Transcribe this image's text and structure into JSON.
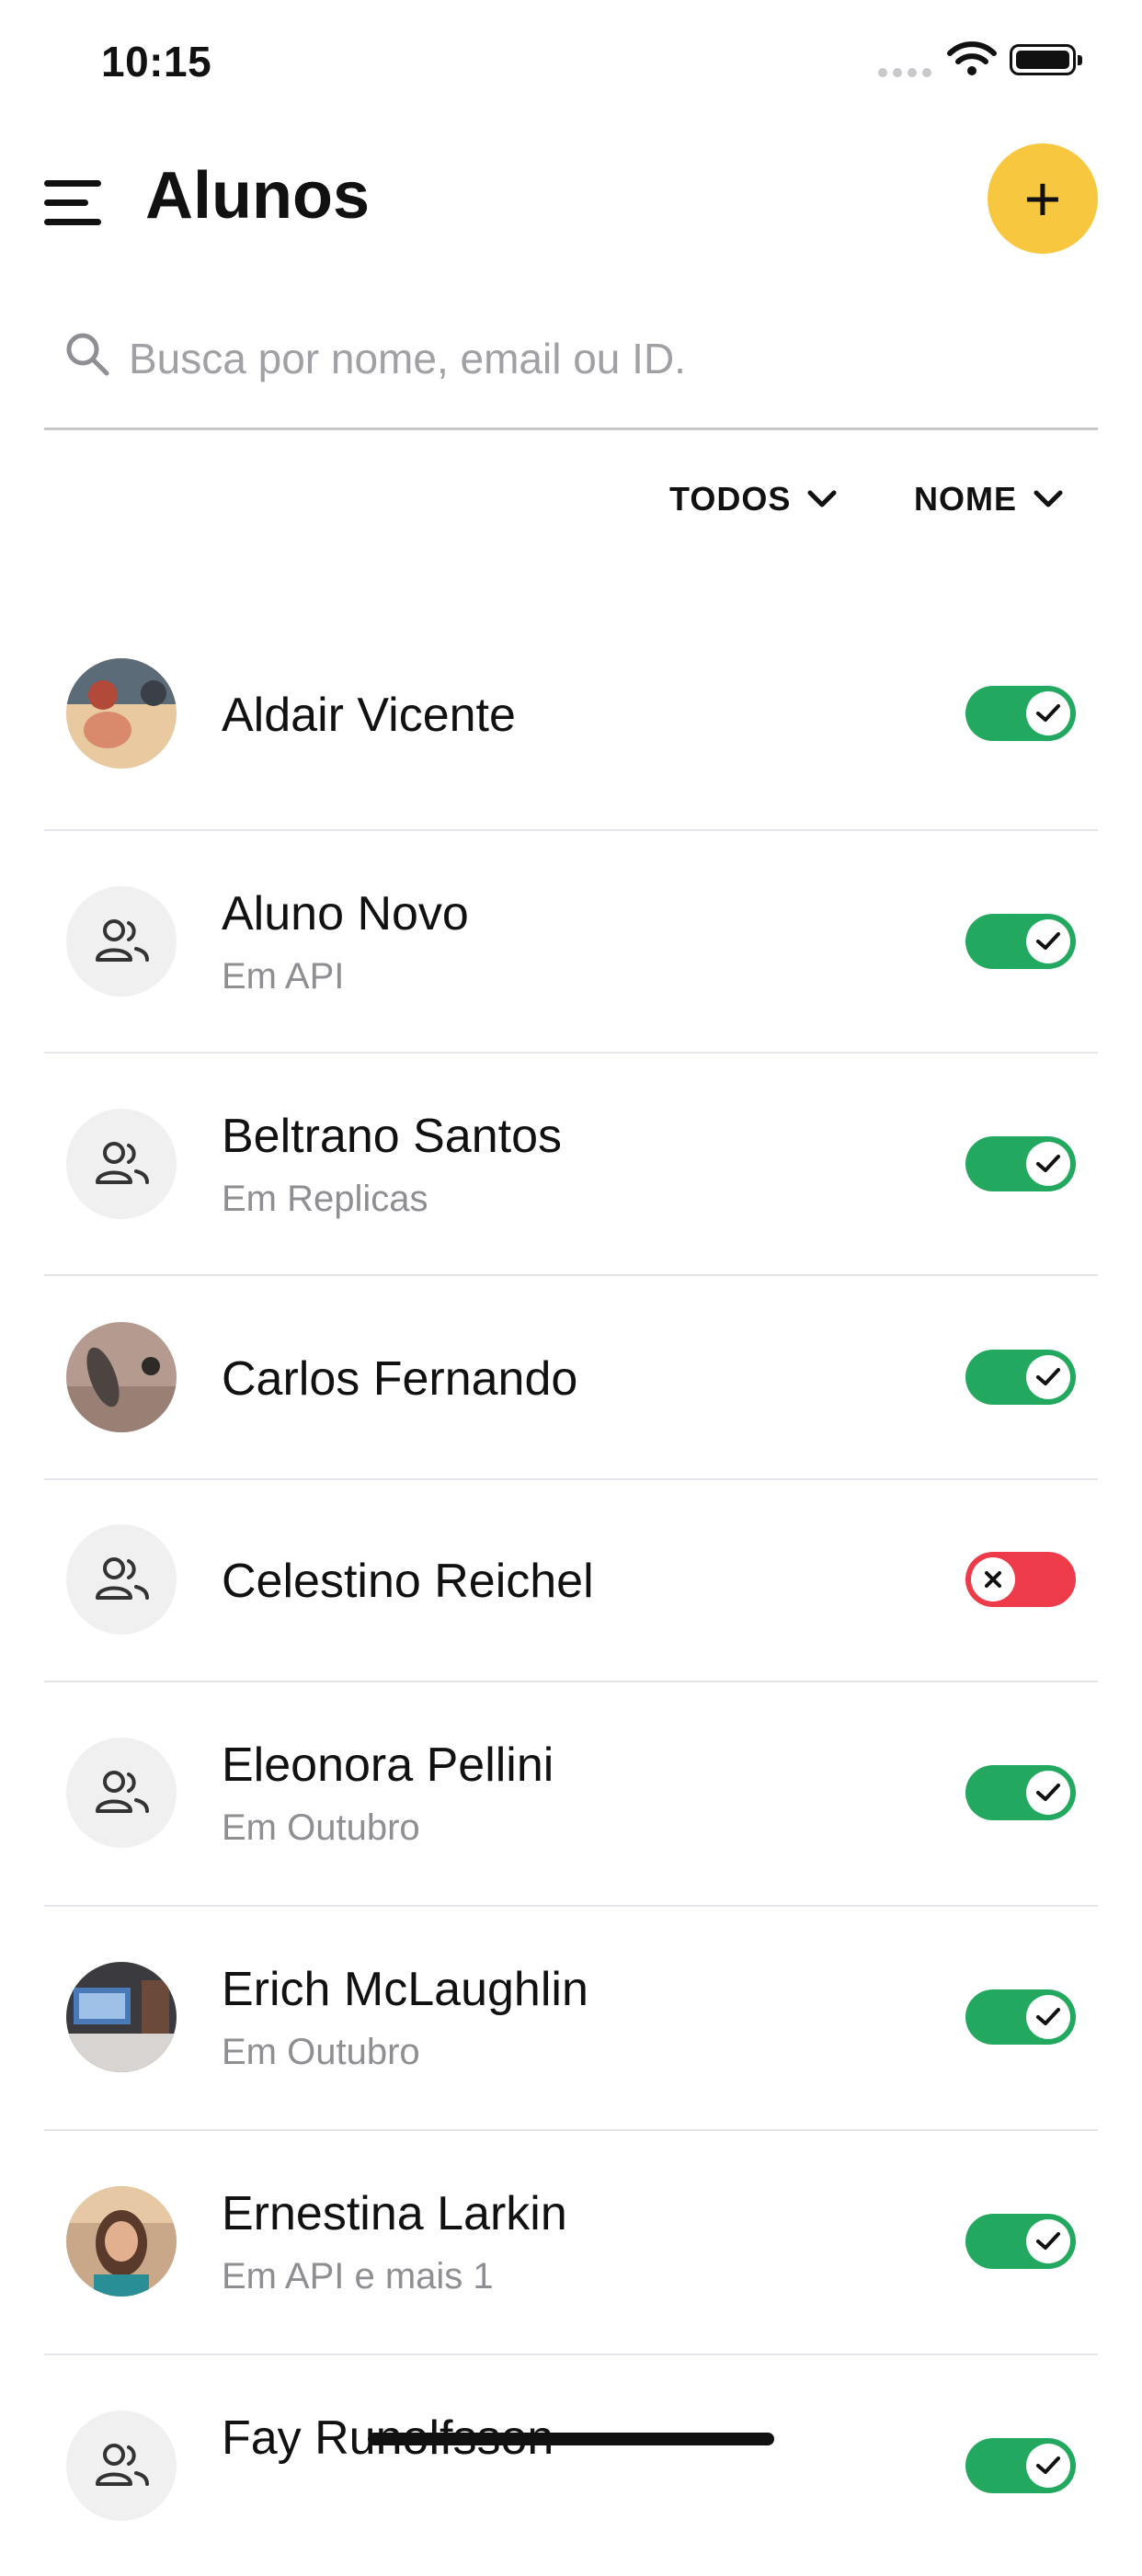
{
  "status_bar": {
    "time": "10:15"
  },
  "header": {
    "title": "Alunos",
    "add_label": "+"
  },
  "search": {
    "placeholder": "Busca por nome, email ou ID.",
    "value": ""
  },
  "filters": {
    "status_label": "TODOS",
    "sort_label": "NOME"
  },
  "students": [
    {
      "name": "Aldair Vicente",
      "subtitle": "",
      "avatar": "photo",
      "active": true
    },
    {
      "name": "Aluno Novo",
      "subtitle": "Em API",
      "avatar": "group-icon",
      "active": true
    },
    {
      "name": "Beltrano Santos",
      "subtitle": "Em Replicas",
      "avatar": "group-icon",
      "active": true
    },
    {
      "name": "Carlos Fernando",
      "subtitle": "",
      "avatar": "photo",
      "active": true
    },
    {
      "name": "Celestino Reichel",
      "subtitle": "",
      "avatar": "group-icon",
      "active": false
    },
    {
      "name": "Eleonora Pellini",
      "subtitle": "Em Outubro",
      "avatar": "group-icon",
      "active": true
    },
    {
      "name": "Erich McLaughlin",
      "subtitle": "Em Outubro",
      "avatar": "photo",
      "active": true
    },
    {
      "name": "Ernestina Larkin",
      "subtitle": "Em API e mais 1",
      "avatar": "photo",
      "active": true
    },
    {
      "name": "Fay Runolfsson",
      "subtitle": "",
      "avatar": "group-icon",
      "active": true
    }
  ],
  "colors": {
    "accent": "#f7c83f",
    "active": "#22a95f",
    "inactive": "#ee3b4a",
    "muted_text": "#8e8e93"
  }
}
